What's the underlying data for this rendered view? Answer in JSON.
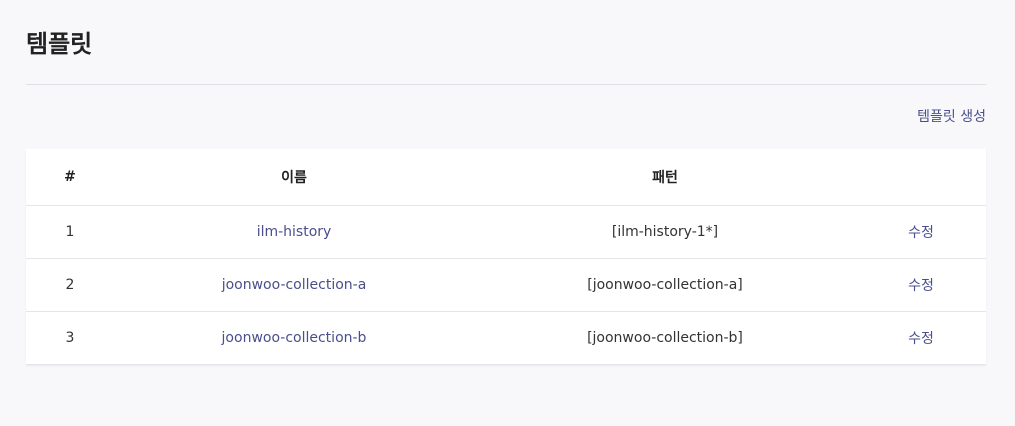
{
  "page": {
    "title": "템플릿",
    "create_label": "템플릿 생성"
  },
  "table": {
    "headers": {
      "index": "#",
      "name": "이름",
      "pattern": "패턴",
      "action": ""
    },
    "rows": [
      {
        "index": "1",
        "name": "ilm-history",
        "pattern": "[ilm-history-1*]",
        "action": "수정"
      },
      {
        "index": "2",
        "name": "joonwoo-collection-a",
        "pattern": "[joonwoo-collection-a]",
        "action": "수정"
      },
      {
        "index": "3",
        "name": "joonwoo-collection-b",
        "pattern": "[joonwoo-collection-b]",
        "action": "수정"
      }
    ]
  },
  "colors": {
    "background": "#f8f8fa",
    "link": "#4a4f8c",
    "text": "#333333"
  }
}
